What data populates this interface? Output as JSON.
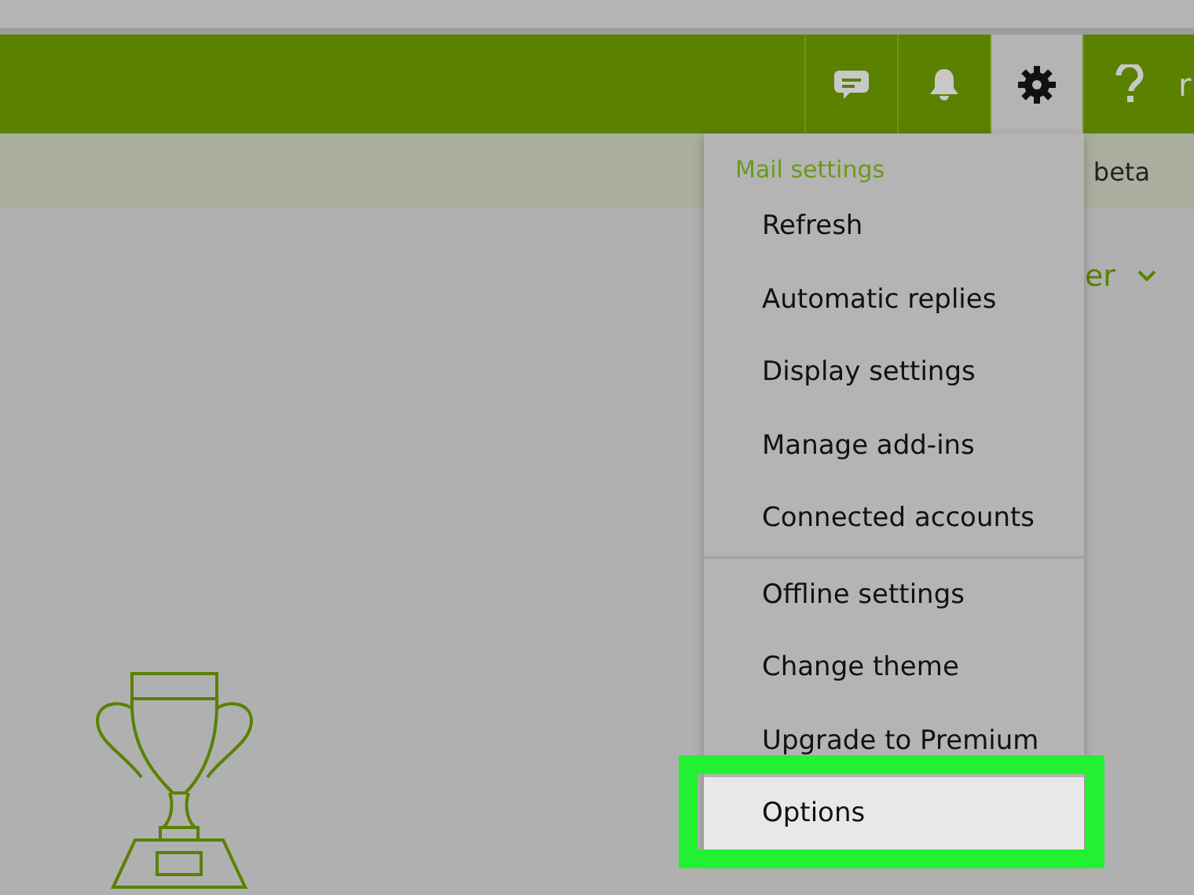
{
  "header": {
    "icons": [
      {
        "kind": "chat",
        "selected": false
      },
      {
        "kind": "bell",
        "selected": false
      },
      {
        "kind": "gear",
        "selected": true
      },
      {
        "kind": "help",
        "selected": false
      }
    ],
    "cut_text": "r"
  },
  "subbar": {
    "text": "beta"
  },
  "content": {
    "filter_text": "er"
  },
  "menu": {
    "heading": "Mail settings",
    "sections": [
      {
        "items": [
          {
            "label": "Refresh",
            "selected": false
          },
          {
            "label": "Automatic replies",
            "selected": false
          },
          {
            "label": "Display settings",
            "selected": false
          },
          {
            "label": "Manage add-ins",
            "selected": false
          },
          {
            "label": "Connected accounts",
            "selected": false
          }
        ]
      },
      {
        "items": [
          {
            "label": "Offline settings",
            "selected": false
          },
          {
            "label": "Change theme",
            "selected": false
          },
          {
            "label": "Upgrade to Premium",
            "selected": false
          },
          {
            "label": "Options",
            "selected": true
          }
        ]
      }
    ]
  }
}
